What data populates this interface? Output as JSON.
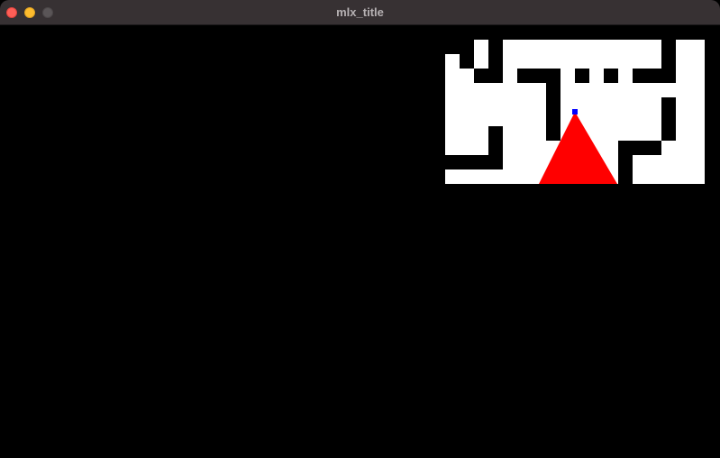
{
  "window": {
    "title": "mlx_title"
  },
  "colors": {
    "titlebar": "#373133",
    "background": "#000000",
    "wall": "#000000",
    "floor": "#ffffff",
    "view_cone": "#ff0000",
    "player": "#0000ff"
  },
  "icons": {
    "close": "close-icon",
    "minimize": "minimize-icon",
    "zoom": "zoom-icon"
  }
}
